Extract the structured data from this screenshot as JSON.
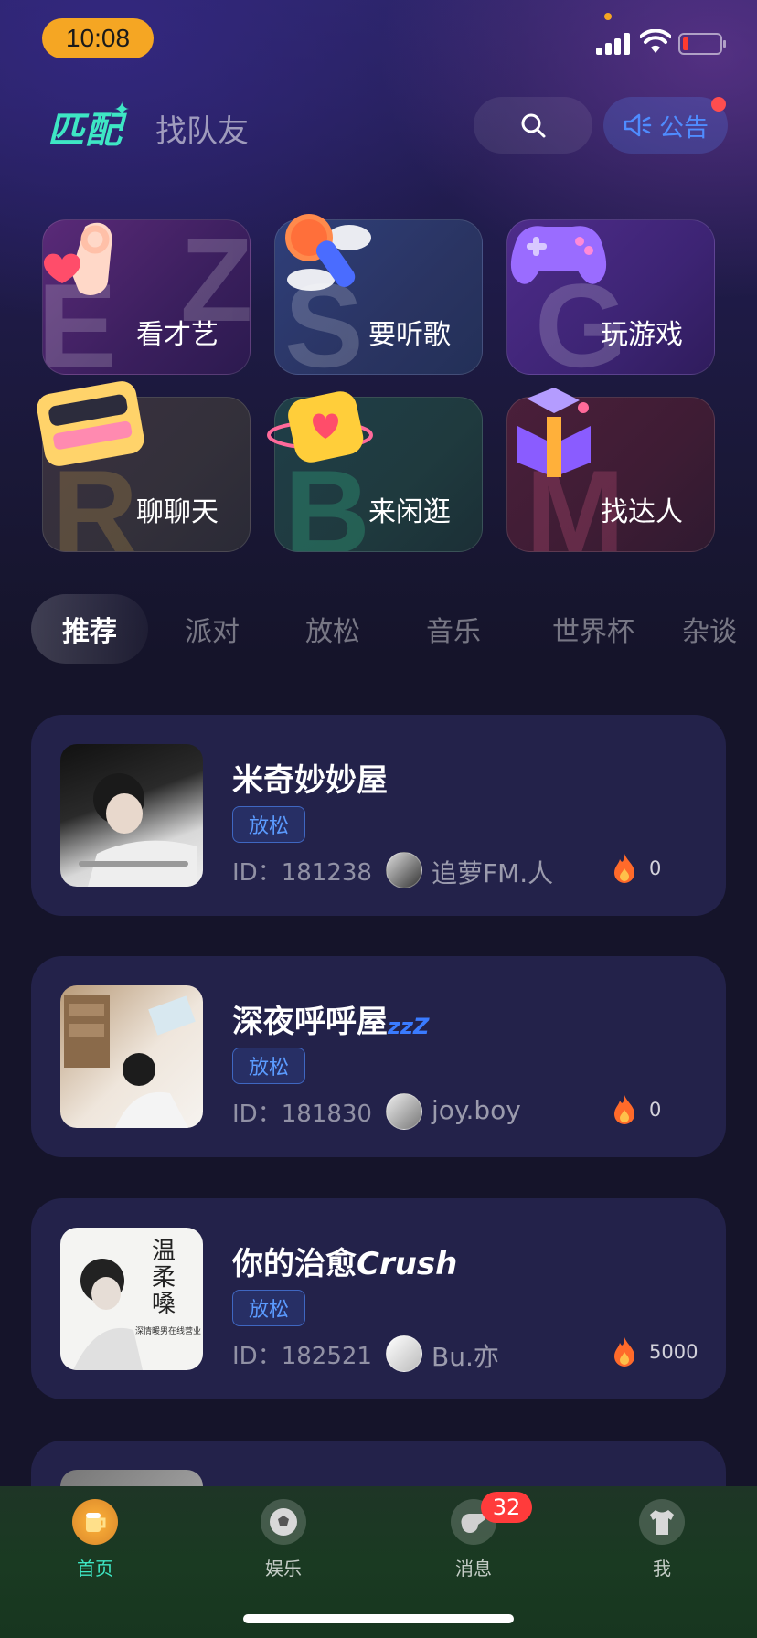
{
  "status_bar": {
    "time": "10:08"
  },
  "header": {
    "tabs": [
      {
        "label": "匹配"
      },
      {
        "label": "找队友"
      }
    ],
    "notice_label": "公告"
  },
  "categories": [
    {
      "label": "看才艺",
      "icon": "ok-hand-heart-icon"
    },
    {
      "label": "要听歌",
      "icon": "microphone-icon"
    },
    {
      "label": "玩游戏",
      "icon": "gamepad-icon"
    },
    {
      "label": "聊聊天",
      "icon": "cassette-icon"
    },
    {
      "label": "来闲逛",
      "icon": "heart-speech-bubble-icon"
    },
    {
      "label": "找达人",
      "icon": "gift-box-icon"
    }
  ],
  "filter_tabs": [
    {
      "label": "推荐",
      "active": true
    },
    {
      "label": "派对"
    },
    {
      "label": "放松"
    },
    {
      "label": "音乐"
    },
    {
      "label": "世界杯"
    },
    {
      "label": "杂谈"
    }
  ],
  "rooms": [
    {
      "title": "米奇妙妙屋",
      "tag": "放松",
      "id_text": "ID：181238",
      "owner": "追萝FM.人",
      "heat": "0"
    },
    {
      "title": "深夜呼呼屋",
      "title_suffix": "zzZ",
      "tag": "放松",
      "id_text": "ID：181830",
      "owner": "joy.boy",
      "heat": "0"
    },
    {
      "title": "你的治愈",
      "title_em": "Crush",
      "tag": "放松",
      "id_text": "ID：182521",
      "owner": "Bu.亦",
      "heat": "5000",
      "cover_text": "温柔嗓",
      "cover_caption": "深情暖男在线营业"
    }
  ],
  "bottom_nav": [
    {
      "label": "首页",
      "icon": "beer-mug-icon",
      "active": true
    },
    {
      "label": "娱乐",
      "icon": "soccer-ball-icon"
    },
    {
      "label": "消息",
      "icon": "whistle-icon",
      "badge": "32"
    },
    {
      "label": "我",
      "icon": "jersey-icon"
    }
  ],
  "colors": {
    "accent": "#3ee6c4",
    "tag_blue": "#5b9bff",
    "badge_red": "#ff3b3b",
    "time_pill": "#f5a623"
  }
}
